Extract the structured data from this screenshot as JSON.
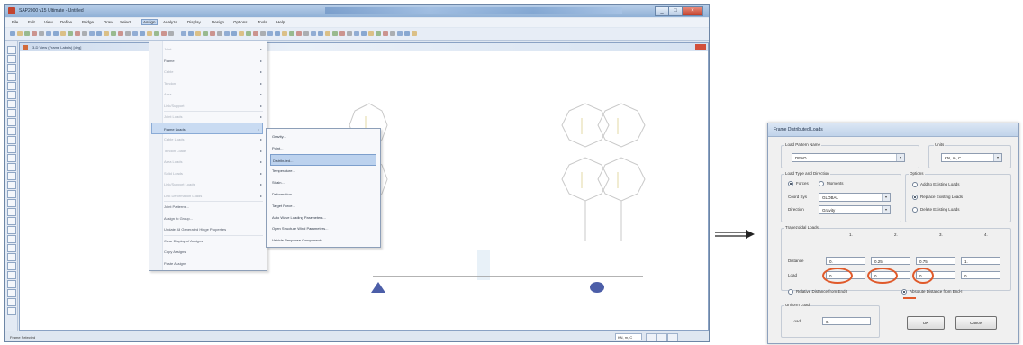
{
  "app": {
    "title": "SAP2000 v15 Ultimate - Untitled",
    "menu": [
      "File",
      "Edit",
      "View",
      "Define",
      "Bridge",
      "Draw",
      "Select",
      "Assign",
      "Analyze",
      "Display",
      "Design",
      "Options",
      "Tools",
      "Help"
    ],
    "active_menu": "Assign",
    "status_text": "Frame Selected",
    "units": "KN, m, C"
  },
  "document": {
    "title": "3-D View  (Frame Labels)  [deg]"
  },
  "assign_menu": {
    "items": [
      {
        "label": "Joint",
        "dim": true,
        "submenu": true
      },
      {
        "label": "Frame",
        "dim": false,
        "submenu": true
      },
      {
        "label": "Cable",
        "dim": true,
        "submenu": true
      },
      {
        "label": "Tendon",
        "dim": true,
        "submenu": true
      },
      {
        "label": "Area",
        "dim": true,
        "submenu": true
      },
      {
        "label": "Link/Support",
        "dim": true,
        "submenu": true
      },
      {
        "label": "Joint Loads",
        "dim": true,
        "submenu": true
      },
      {
        "label": "Frame Loads",
        "dim": false,
        "submenu": true,
        "highlight": true
      },
      {
        "label": "Cable Loads",
        "dim": true,
        "submenu": true
      },
      {
        "label": "Tendon Loads",
        "dim": true,
        "submenu": true
      },
      {
        "label": "Area Loads",
        "dim": true,
        "submenu": true
      },
      {
        "label": "Solid Loads",
        "dim": true,
        "submenu": true
      },
      {
        "label": "Link/Support Loads",
        "dim": true,
        "submenu": true
      },
      {
        "label": "Link Deformation Loads",
        "dim": true,
        "submenu": true
      },
      {
        "label": "Joint Patterns...",
        "dim": false,
        "submenu": false
      },
      {
        "label": "Assign to Group...",
        "dim": false,
        "submenu": false
      },
      {
        "label": "Update All Generated Hinge Properties",
        "dim": false,
        "submenu": false
      },
      {
        "label": "Clear Display of Assigns",
        "dim": false,
        "submenu": false
      },
      {
        "label": "Copy Assigns",
        "dim": false,
        "submenu": false
      },
      {
        "label": "Paste Assigns",
        "dim": false,
        "submenu": false
      }
    ]
  },
  "frame_loads_submenu": {
    "items": [
      {
        "label": "Gravity...",
        "highlight": false
      },
      {
        "label": "Point...",
        "highlight": false
      },
      {
        "label": "Distributed...",
        "highlight": true
      },
      {
        "label": "Temperature...",
        "highlight": false
      },
      {
        "label": "Strain...",
        "highlight": false
      },
      {
        "label": "Deformation...",
        "highlight": false
      },
      {
        "label": "Target Force...",
        "highlight": false
      },
      {
        "label": "Auto Wave Loading Parameters...",
        "highlight": false
      },
      {
        "label": "Open Structure Wind Parameters...",
        "highlight": false
      },
      {
        "label": "Vehicle Response Components...",
        "highlight": false
      }
    ]
  },
  "dialog": {
    "title": "Frame Distributed Loads",
    "load_pattern_label": "Load Pattern Name",
    "load_pattern_value": "DEAD",
    "units_label": "Units",
    "units_value": "KN, m, C",
    "load_type_group": "Load Type and Direction",
    "forces_label": "Forces",
    "moments_label": "Moments",
    "coord_sys_label": "Coord Sys",
    "coord_sys_value": "GLOBAL",
    "direction_label": "Direction",
    "direction_value": "Gravity",
    "options_group": "Options",
    "option_add": "Add to Existing Loads",
    "option_replace": "Replace Existing Loads",
    "option_delete": "Delete Existing Loads",
    "trap_group": "Trapezoidal Loads",
    "col_headers": [
      "1.",
      "2.",
      "3.",
      "4."
    ],
    "distance_label": "Distance",
    "distance_values": [
      "0.",
      "0.25",
      "0.75",
      "1."
    ],
    "load_label": "Load",
    "load_values": [
      "0.",
      "0.",
      "0.",
      "0."
    ],
    "relative_label": "Relative Distance from End-I",
    "absolute_label": "Absolute Distance from End-I",
    "uniform_group": "Uniform Load",
    "uniform_load_label": "Load",
    "uniform_load_value": "0.",
    "ok_label": "OK",
    "cancel_label": "Cancel"
  },
  "colors": {
    "annotation": "#e05a2b",
    "support_marker": "#4c5ea8",
    "titlebar": "#8fb0d6"
  }
}
